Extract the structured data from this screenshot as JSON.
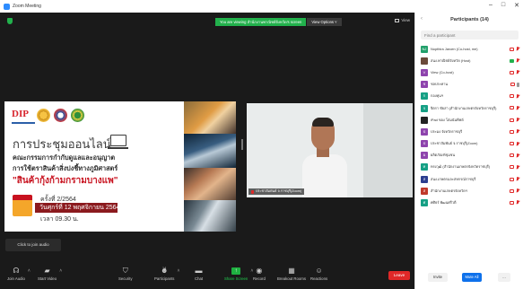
{
  "window": {
    "title": "Zoom Meeting",
    "controls": [
      "–",
      "□",
      "✕"
    ]
  },
  "viewing_bar": {
    "text": "You are viewing สำนักงานพาณิชย์จังหวัด's screen",
    "options_label": "View Options ˅"
  },
  "view_label": "View",
  "slide": {
    "logo_text": "DIP",
    "title": "การประชุมออนไลน์",
    "line1": "คณะกรรมการกำกับดูแลและอนุญาต",
    "line2": "การใช้ตราสินค้าสิ่งบ่งชี้ทางภูมิศาสตร์",
    "line3": "\"สินค้ากุ้งก้ามกรามบางแพ\"",
    "meeting_no": "ครั้งที่ 2/2564",
    "date": "วันศุกร์ที่ 12 พฤศจิกายน 2564",
    "time": "เวลา 09.30 น."
  },
  "video": {
    "name": "ประชาสัมพันธ์ จ.ราชบุรี(Zoom)"
  },
  "join_audio_label": "Click to join audio",
  "toolbar": {
    "join_audio": "Join Audio",
    "start_video": "Start Video",
    "security": "Security",
    "participants": "Participants",
    "participants_count": "14",
    "chat": "Chat",
    "share_screen": "Share Screen",
    "record": "Record",
    "breakout": "Breakout Rooms",
    "reactions": "Reactions",
    "leave": "Leave"
  },
  "panel": {
    "title": "Participants (14)",
    "search_placeholder": "Find a participant",
    "participants": [
      {
        "name": "Nopthira Jaroen (Co-host, me)",
        "initials": "NJ",
        "color": "#22a06b",
        "cam": "off",
        "mic": "off"
      },
      {
        "name": "สนง.พาณิชย์จังหวัด (Host)",
        "initials": "",
        "color": "#6b4a3a",
        "cam": "on",
        "mic": "off"
      },
      {
        "name": "View (Co-host)",
        "initials": "V",
        "color": "#8e44ad",
        "cam": "off",
        "mic": "off"
      },
      {
        "name": "ชลประทาน",
        "initials": "ช",
        "color": "#8e44ad",
        "cam": "off",
        "mic": "on"
      },
      {
        "name": "กองทุนฯ",
        "initials": "ก",
        "color": "#16a085",
        "cam": "off",
        "mic": "off"
      },
      {
        "name": "จิตรา ชัยสา (สำนักงานเกษตรจังหวัดราชบุรี)",
        "initials": "จ",
        "color": "#16a085",
        "cam": "off",
        "mic": "off"
      },
      {
        "name": "iPad ของ โสมฉันทิพย์",
        "initials": "",
        "color": "#222222",
        "cam": "off",
        "mic": "off"
      },
      {
        "name": "ประมง จังหวัดราชบุรี",
        "initials": "ป",
        "color": "#8e44ad",
        "cam": "off",
        "mic": "off"
      },
      {
        "name": "ประชาสัมพันธ์ จ.ราชบุรี(Zoom)",
        "initials": "ป",
        "color": "#8e44ad",
        "cam": "off",
        "mic": "off"
      },
      {
        "name": "ผลิตภัณฑ์ชุมชน",
        "initials": "ผ",
        "color": "#8e44ad",
        "cam": "off",
        "mic": "off"
      },
      {
        "name": "ทรงวุฒิ (สำนักงานเกษตรจังหวัดราชบุรี)",
        "initials": "ท",
        "color": "#16a085",
        "cam": "off",
        "mic": "off"
      },
      {
        "name": "สนง.เกษตรและสหกรณ์ราชบุรี",
        "initials": "ส",
        "color": "#2c3e8f",
        "cam": "off",
        "mic": "off"
      },
      {
        "name": "สำนักงานเกษตรจังหวัดฯ",
        "initials": "ส",
        "color": "#c0392b",
        "cam": "off",
        "mic": "off"
      },
      {
        "name": "ศศิธร์ พัฒนศรีวดี",
        "initials": "ศ",
        "color": "#16a085",
        "cam": "off",
        "mic": "off"
      }
    ],
    "invite_label": "Invite",
    "mute_all_label": "Mute All",
    "more_label": "..."
  }
}
